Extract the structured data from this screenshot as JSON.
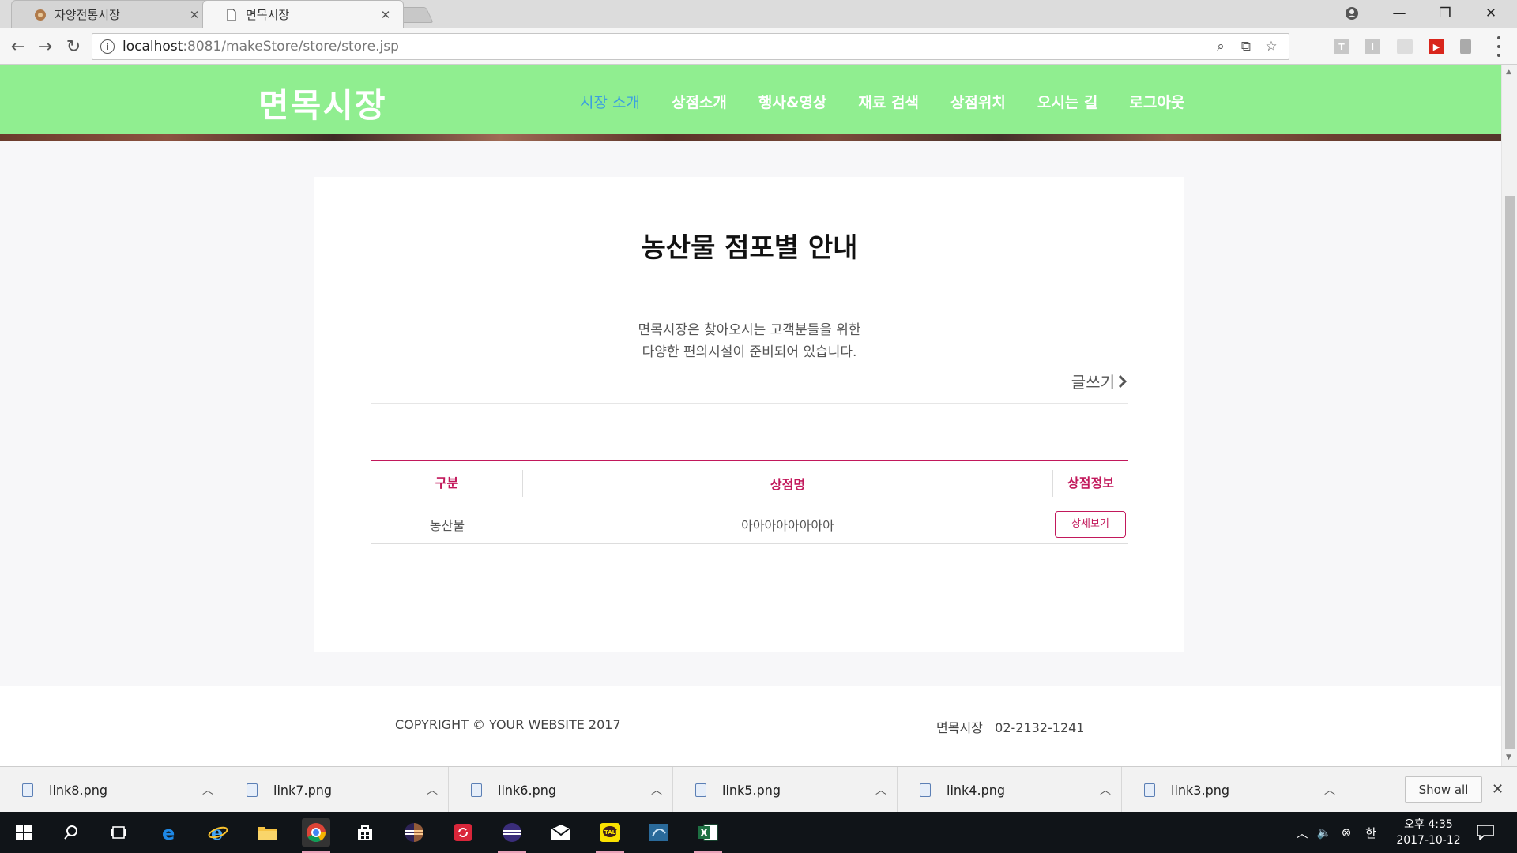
{
  "browser": {
    "tabs": [
      {
        "title": "자양전통시장",
        "active": false
      },
      {
        "title": "면목시장",
        "active": true
      }
    ],
    "url_host": "localhost",
    "url_rest": ":8081/makeStore/store/store.jsp",
    "extensions": [
      "T",
      "I",
      "",
      "",
      ""
    ]
  },
  "site": {
    "logo": "면목시장",
    "nav": [
      {
        "label": "시장 소개",
        "active": true
      },
      {
        "label": "상점소개",
        "active": false
      },
      {
        "label": "행사&영상",
        "active": false
      },
      {
        "label": "재료 검색",
        "active": false
      },
      {
        "label": "상점위치",
        "active": false
      },
      {
        "label": "오시는 길",
        "active": false
      },
      {
        "label": "로그아웃",
        "active": false
      }
    ],
    "colors": {
      "nav_bg": "#90ee90",
      "accent": "#c2185b",
      "nav_active": "#3b9fe0"
    }
  },
  "main": {
    "title": "농산물 점포별 안내",
    "desc_line1": "면목시장은 찾아오시는 고객분들을 위한",
    "desc_line2": "다양한 편의시설이 준비되어 있습니다.",
    "write_label": "글쓰기",
    "table": {
      "headers": [
        "구분",
        "상점명",
        "상점정보"
      ],
      "rows": [
        {
          "category": "농산물",
          "name": "아아아아아아아아",
          "button": "상세보기"
        }
      ]
    }
  },
  "footer": {
    "copyright": "COPYRIGHT © YOUR WEBSITE 2017",
    "contact": "면목시장   02-2132-1241"
  },
  "downloads": {
    "files": [
      "link8.png",
      "link7.png",
      "link6.png",
      "link5.png",
      "link4.png",
      "link3.png"
    ],
    "show_all": "Show all"
  },
  "taskbar": {
    "ime": "한",
    "time": "오후 4:35",
    "date": "2017-10-12"
  }
}
